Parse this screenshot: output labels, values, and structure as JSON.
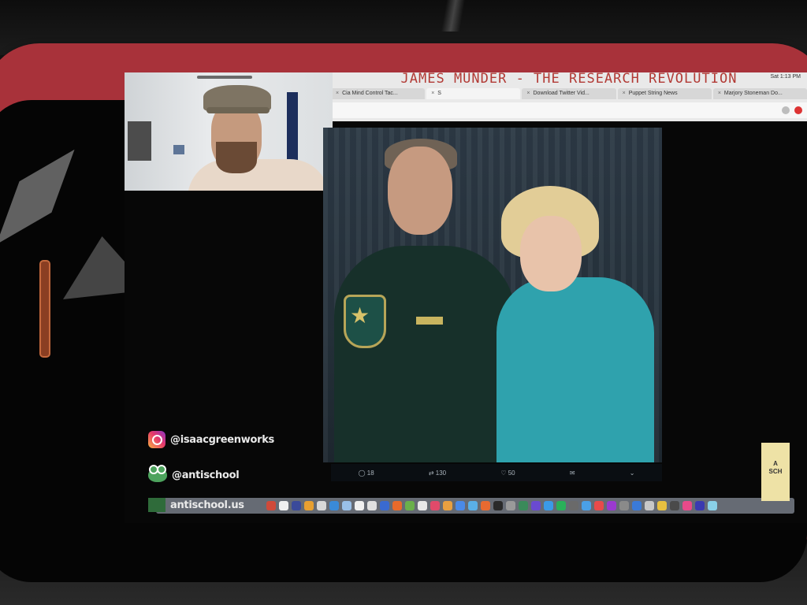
{
  "stream": {
    "title": "JAMES MUNDER - THE RESEARCH REVOLUTION",
    "clock": "Sat 1:13 PM"
  },
  "browser": {
    "tabs": [
      {
        "label": "Cia Mind Control Tac...",
        "active": false
      },
      {
        "label": "S",
        "active": true
      },
      {
        "label": "Download Twitter Vid...",
        "active": false
      },
      {
        "label": "Puppet String News",
        "active": false
      },
      {
        "label": "Marjory Stoneman Do...",
        "active": false
      }
    ]
  },
  "tweet": {
    "actions": [
      {
        "icon": "reply-icon",
        "count": "18"
      },
      {
        "icon": "retweet-icon",
        "count": "130"
      },
      {
        "icon": "like-icon",
        "count": "50"
      },
      {
        "icon": "message-icon",
        "count": ""
      },
      {
        "icon": "chevron-down-icon",
        "count": ""
      }
    ]
  },
  "overlay": {
    "instagram": "@isaacgreenworks",
    "twitter": "@antischool",
    "website": "antischool.us"
  },
  "sticky_note": {
    "text": "A\nSCH"
  },
  "colors": {
    "phone_case": "#a8323a",
    "title_text": "#b23a35",
    "officer_uniform": "#17302a",
    "teal_jacket": "#2fa2ad"
  },
  "dock_icons": [
    "#d04a3a",
    "#f0f0f0",
    "#3a4a9a",
    "#e8a030",
    "#d8d8d8",
    "#3a8ad8",
    "#9ac0e8",
    "#f0f0f0",
    "#e0e0e0",
    "#3a6ad0",
    "#e86a2a",
    "#6ab04a",
    "#e8e8e8",
    "#e04a6a",
    "#e8a040",
    "#4a8ae8",
    "#5ab0e8",
    "#e86a30",
    "#2a2a2a",
    "#9a9a9a",
    "#3a8a5a",
    "#6a4ad0",
    "#3a9ae8",
    "#2ab05a",
    "#6a6a6a",
    "#4aa0e8",
    "#e84a4a",
    "#9a3ad0",
    "#8a8a8a",
    "#3a7ad8",
    "#c8c8c8",
    "#e8c040",
    "#4a4a4a",
    "#e84a8a",
    "#3a3ab0",
    "#8ad0e8"
  ]
}
